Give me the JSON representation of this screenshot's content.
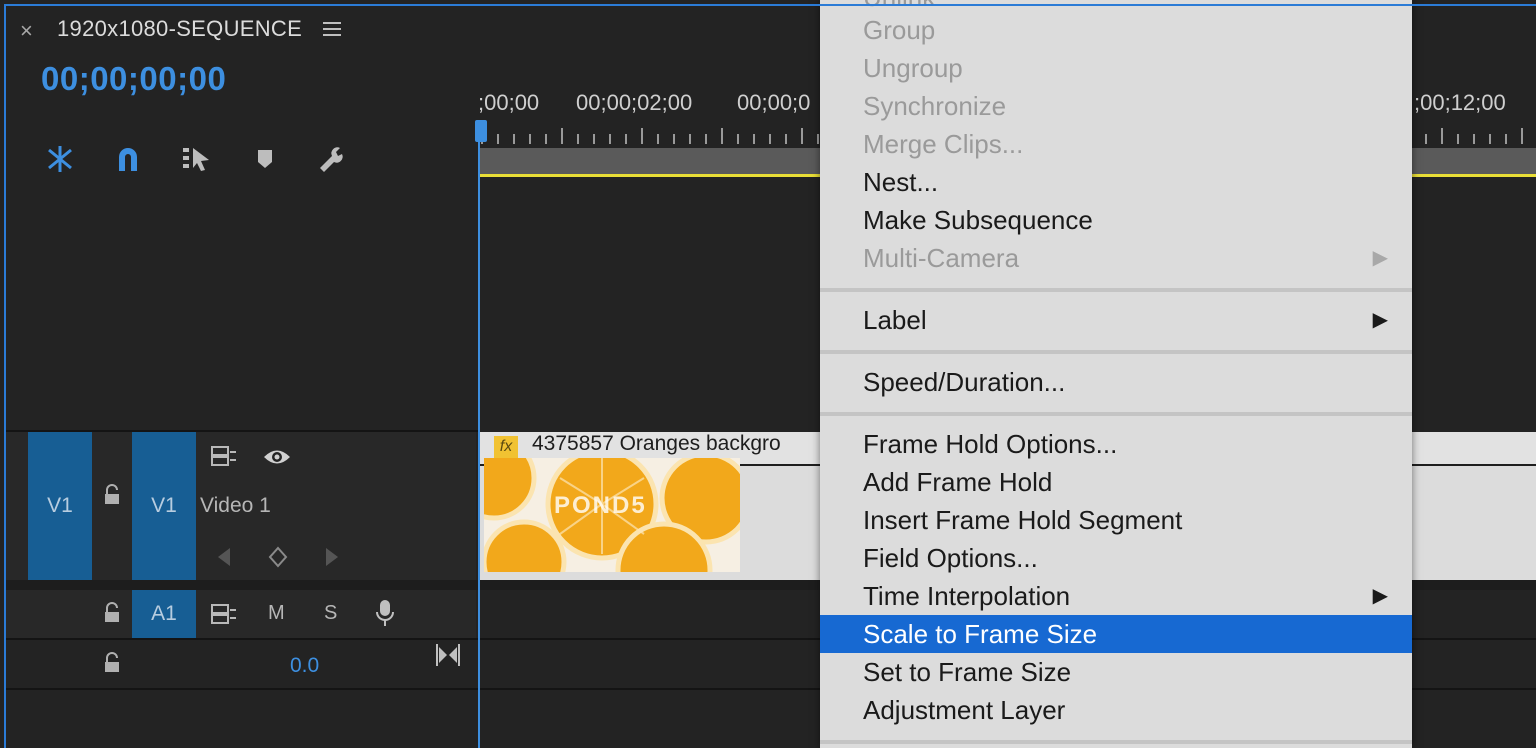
{
  "sequence": {
    "close_glyph": "×",
    "title": "1920x1080-SEQUENCE",
    "timecode": "00;00;00;00"
  },
  "toolbar": {
    "icons": [
      "snap-insert-icon",
      "magnet-icon",
      "linked-selection-icon",
      "marker-icon",
      "wrench-icon"
    ]
  },
  "ruler": {
    "labels": [
      ";00;00",
      "00;00;02;00",
      "00;00;0",
      ";00;12;00"
    ]
  },
  "tracks": {
    "v1": {
      "source_label": "V1",
      "target_label": "V1",
      "name": "Video 1"
    },
    "a1": {
      "target_label": "A1",
      "mute": "M",
      "solo": "S"
    },
    "master": {
      "volume": "0.0"
    }
  },
  "clip": {
    "fx": "fx",
    "name": "4375857 Oranges backgro",
    "watermark": "POND5"
  },
  "context_menu": {
    "items": [
      {
        "label": "Unlink",
        "state": "disabled"
      },
      {
        "label": "Group",
        "state": "disabled"
      },
      {
        "label": "Ungroup",
        "state": "disabled"
      },
      {
        "label": "Synchronize",
        "state": "disabled"
      },
      {
        "label": "Merge Clips...",
        "state": "disabled"
      },
      {
        "label": "Nest...",
        "state": "enabled"
      },
      {
        "label": "Make Subsequence",
        "state": "enabled"
      },
      {
        "label": "Multi-Camera",
        "state": "disabled",
        "submenu": true
      },
      {
        "label": "Label",
        "state": "enabled",
        "submenu": true
      },
      {
        "label": "Speed/Duration...",
        "state": "enabled"
      },
      {
        "label": "Frame Hold Options...",
        "state": "enabled"
      },
      {
        "label": "Add Frame Hold",
        "state": "enabled"
      },
      {
        "label": "Insert Frame Hold Segment",
        "state": "enabled"
      },
      {
        "label": "Field Options...",
        "state": "enabled"
      },
      {
        "label": "Time Interpolation",
        "state": "enabled",
        "submenu": true
      },
      {
        "label": "Scale to Frame Size",
        "state": "selected"
      },
      {
        "label": "Set to Frame Size",
        "state": "enabled"
      },
      {
        "label": "Adjustment Layer",
        "state": "enabled"
      }
    ],
    "submenu_arrow": "▶"
  },
  "colors": {
    "accent": "#3d8fe0",
    "selection": "#1769d2",
    "track_target": "#175e94",
    "work_area": "#e9de37"
  }
}
